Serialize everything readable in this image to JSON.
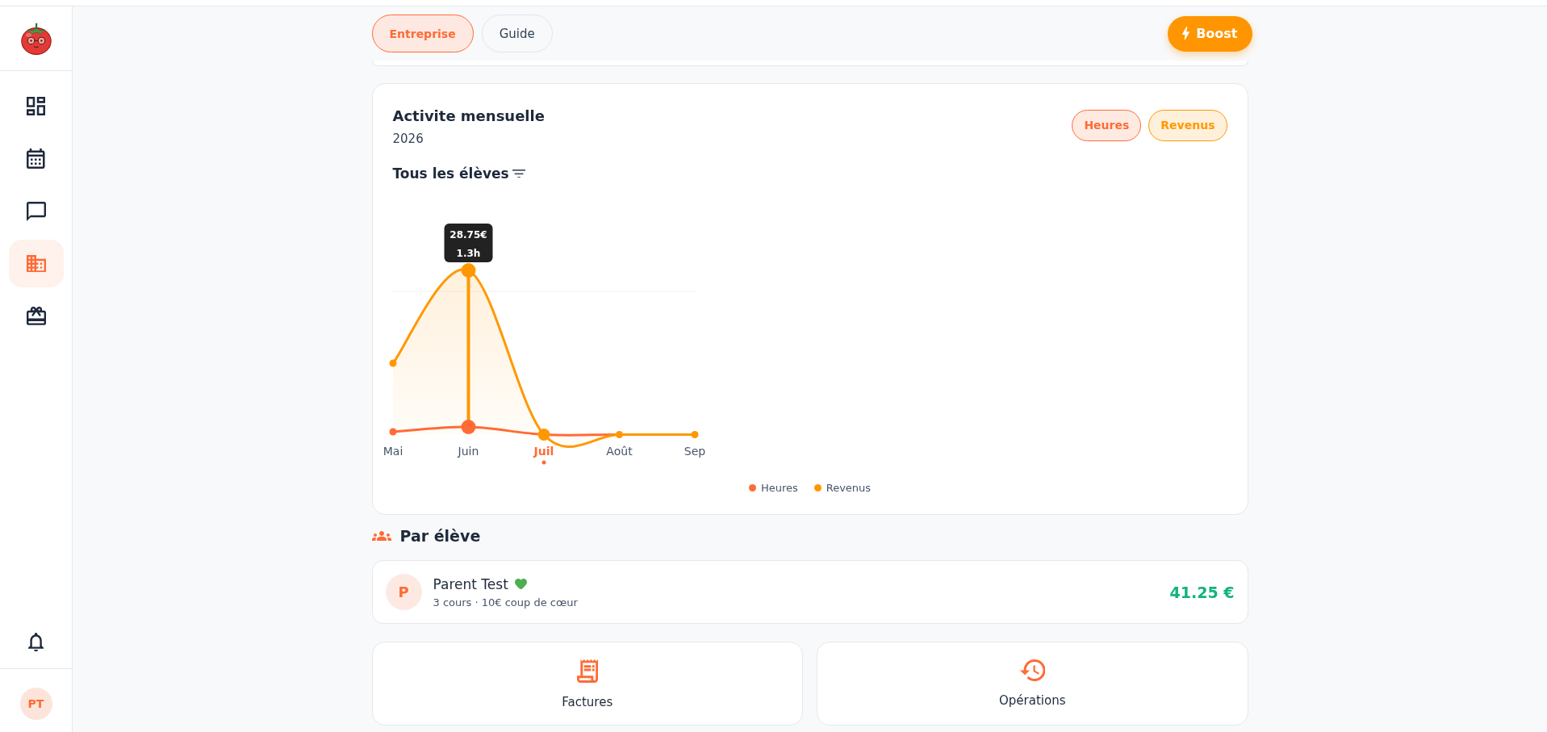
{
  "sidebar": {
    "nav": [
      {
        "kind": "dashboard",
        "selected": false
      },
      {
        "kind": "calendar",
        "selected": false
      },
      {
        "kind": "messages",
        "selected": false
      },
      {
        "kind": "company",
        "selected": true
      },
      {
        "kind": "gifts",
        "selected": false
      }
    ],
    "avatar": {
      "initials": "PT"
    }
  },
  "header": {
    "tabs": [
      {
        "label": "Entreprise",
        "selected": true
      },
      {
        "label": "Guide",
        "selected": false
      }
    ],
    "boost_button": {
      "label": "Boost"
    }
  },
  "activity": {
    "title": "Activite mensuelle",
    "year": "2026",
    "toggles": [
      {
        "label": "Heures",
        "selected": true,
        "color": "#ff6b35"
      },
      {
        "label": "Revenus",
        "selected": true,
        "color": "#ff9800"
      }
    ],
    "filter": {
      "label": "Tous les élèves"
    },
    "chart": {
      "categories": [
        {
          "label": "Mai",
          "selected": false,
          "current": false
        },
        {
          "label": "Juin",
          "selected": true,
          "current": false
        },
        {
          "label": "Juil",
          "selected": false,
          "current": true
        },
        {
          "label": "Août",
          "selected": false,
          "current": false
        },
        {
          "label": "Sep",
          "selected": false,
          "current": false
        }
      ],
      "tooltip": {
        "lines": [
          "28.75€",
          "1.3h"
        ]
      },
      "series": [
        {
          "name": "Heures",
          "color": "#ff6b35"
        },
        {
          "name": "Revenus",
          "color": "#ff9800"
        }
      ]
    }
  },
  "students": {
    "title": "Par élève",
    "items": [
      {
        "initial": "P",
        "name": "Parent Test",
        "favorite": true,
        "detail": "3 cours · 10€ coup de cœur",
        "amount": "41.25 €"
      }
    ]
  },
  "shortcuts": [
    {
      "kind": "invoices",
      "label": "Factures"
    },
    {
      "kind": "history",
      "label": "Opérations"
    }
  ]
}
